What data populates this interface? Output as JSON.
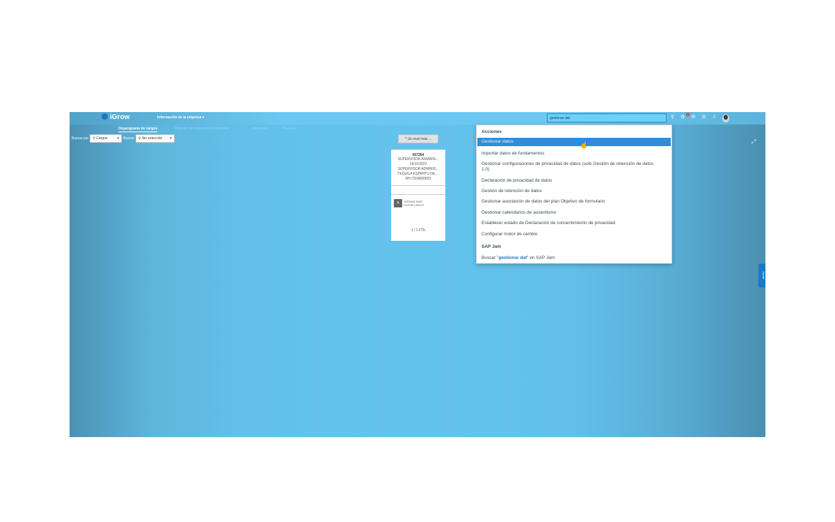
{
  "app": {
    "logo": "iGrow",
    "module": "Información de la empresa ▾",
    "search_value": "gestionar dat",
    "notification_count": "1",
    "icons": [
      "search-icon",
      "bell-badge-icon",
      "chat-icon",
      "document-icon",
      "notification-icon",
      "avatar"
    ]
  },
  "tabs": [
    "Organigrama de cargos",
    "Relación de estructura de empresa",
    "Directorio",
    "Procesos"
  ],
  "filters": {
    "buscar_por_label": "Buscar por",
    "buscar_por_value": "Cargos",
    "buscar_label": "Buscar",
    "buscar_value": "Sin selección"
  },
  "up_level": "^ Un nivel más ...",
  "card": {
    "id": "007264",
    "line1": "SUPERVISOR ADMINIS...",
    "date": "16/11/2023",
    "line2": "SUPERVISOR ADMINIS...",
    "line3": "TEQUILA ESPIRITU DE ...",
    "line4": "RH (TEM00902)",
    "employee_initial": "A",
    "employee_name_1": "JORDAN SAID",
    "employee_name_2": "CASTELLANOS",
    "fte": "1 / 1 FTE"
  },
  "side_tab": "Ayuda",
  "dropdown": {
    "header_actions": "Acciones",
    "items": [
      "Gestionar datos",
      "Importar datos de fundamentos",
      "Gestionar configuraciones de privacidad de datos (solo Gestión de retención de datos",
      "1.0)",
      "Declaración de privacidad de datos",
      "Gestión de retención de datos",
      "Gestionar asociación de datos del plan Objetivo de formulario",
      "Gestionar calendarios de ausentismo",
      "Establecer estado de Declaración de consentimiento de privacidad",
      "Configurar motor de cambio"
    ],
    "header_jam": "SAP Jam",
    "jam_prefix": "Buscar \"",
    "jam_term": "gestionar dat",
    "jam_suffix": "\" en SAP Jam"
  }
}
